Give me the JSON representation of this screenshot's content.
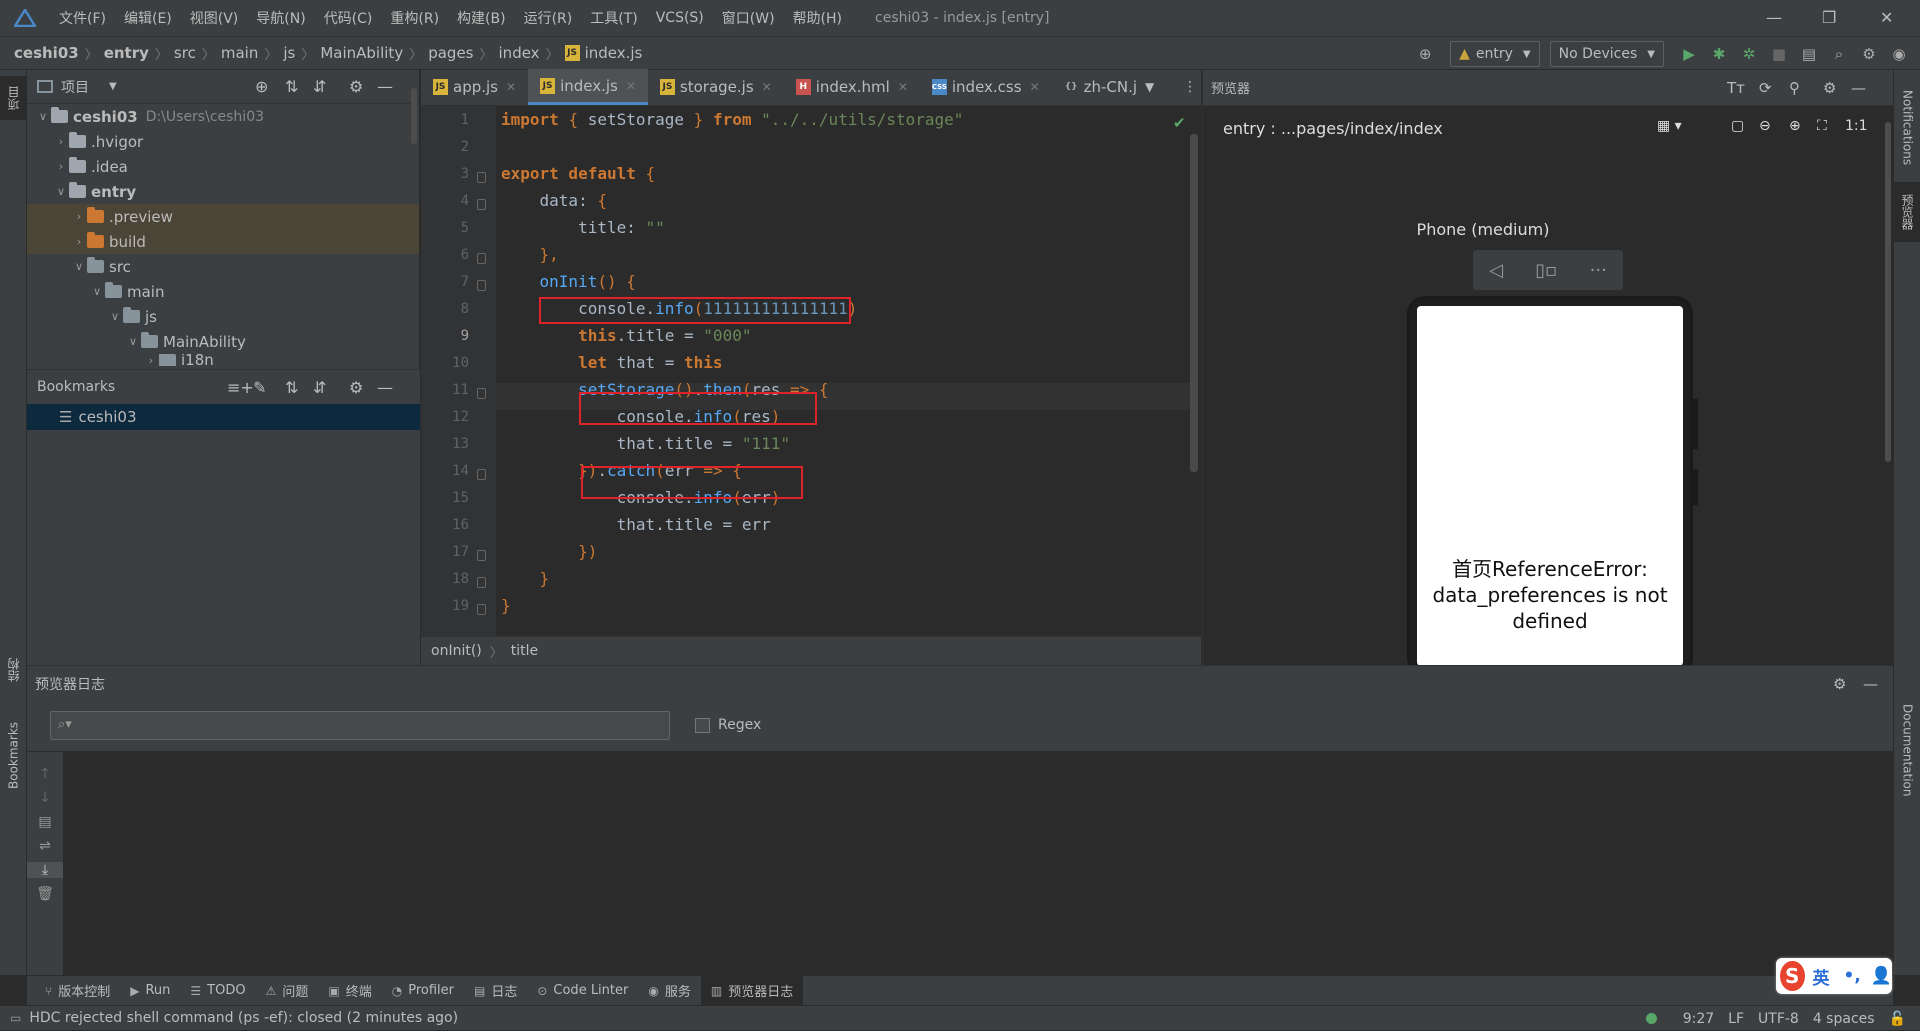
{
  "menubar": {
    "items": [
      "文件(F)",
      "编辑(E)",
      "视图(V)",
      "导航(N)",
      "代码(C)",
      "重构(R)",
      "构建(B)",
      "运行(R)",
      "工具(T)",
      "VCS(S)",
      "窗口(W)",
      "帮助(H)"
    ],
    "window_title": "ceshi03 - index.js [entry]"
  },
  "breadcrumb": [
    "ceshi03",
    "entry",
    "src",
    "main",
    "js",
    "MainAbility",
    "pages",
    "index",
    "index.js"
  ],
  "toolbar": {
    "module": "entry",
    "device": "No Devices"
  },
  "left_strip": {
    "project_tab": "项目",
    "structure_tab": "结构",
    "bookmarks_tab": "Bookmarks"
  },
  "right_strip": {
    "notifications_tab": "Notifications",
    "previewer_tab": "预览器",
    "documentation_tab": "Documentation"
  },
  "project": {
    "title": "项目",
    "tree": [
      {
        "label": "ceshi03",
        "path": "D:\\Users\\ceshi03",
        "depth": 0,
        "open": true,
        "bold": true
      },
      {
        "label": ".hvigor",
        "depth": 1,
        "open": false
      },
      {
        "label": ".idea",
        "depth": 1,
        "open": false
      },
      {
        "label": "entry",
        "depth": 1,
        "open": true,
        "bold": true
      },
      {
        "label": ".preview",
        "depth": 2,
        "open": false,
        "orange": true
      },
      {
        "label": "build",
        "depth": 2,
        "open": false,
        "orange": true
      },
      {
        "label": "src",
        "depth": 2,
        "open": true
      },
      {
        "label": "main",
        "depth": 3,
        "open": true
      },
      {
        "label": "js",
        "depth": 4,
        "open": true
      },
      {
        "label": "MainAbility",
        "depth": 5,
        "open": true
      },
      {
        "label": "i18n",
        "depth": 6,
        "open": false
      }
    ]
  },
  "bookmarks": {
    "title": "Bookmarks",
    "items": [
      "ceshi03"
    ]
  },
  "editor": {
    "tabs": [
      {
        "label": "app.js",
        "icon": "JS"
      },
      {
        "label": "index.js",
        "icon": "JS",
        "active": true
      },
      {
        "label": "storage.js",
        "icon": "JS"
      },
      {
        "label": "index.hml",
        "icon": "H"
      },
      {
        "label": "index.css",
        "icon": "CSS"
      },
      {
        "label": "zh-CN.j",
        "icon": "{}"
      }
    ],
    "line_numbers": [
      "1",
      "2",
      "3",
      "4",
      "5",
      "6",
      "7",
      "8",
      "9",
      "10",
      "11",
      "12",
      "13",
      "14",
      "15",
      "16",
      "17",
      "18",
      "19"
    ],
    "code_breadcrumb": [
      "onInit()",
      "title"
    ]
  },
  "preview": {
    "title": "预览器",
    "path": "entry : ...pages/index/index",
    "device_name": "Phone (medium)",
    "screen_text": "首页ReferenceError: data_preferences is not defined"
  },
  "log": {
    "title": "预览器日志",
    "search_placeholder": "",
    "regex_label": "Regex"
  },
  "tool_tabs": [
    "版本控制",
    "Run",
    "TODO",
    "问题",
    "终端",
    "Profiler",
    "日志",
    "Code Linter",
    "服务",
    "预览器日志"
  ],
  "status": {
    "message": "HDC rejected shell command (ps -ef): closed (2 minutes ago)",
    "position": "9:27",
    "line_sep": "LF",
    "encoding": "UTF-8",
    "indent": "4 spaces"
  },
  "ime": {
    "mode": "英"
  }
}
